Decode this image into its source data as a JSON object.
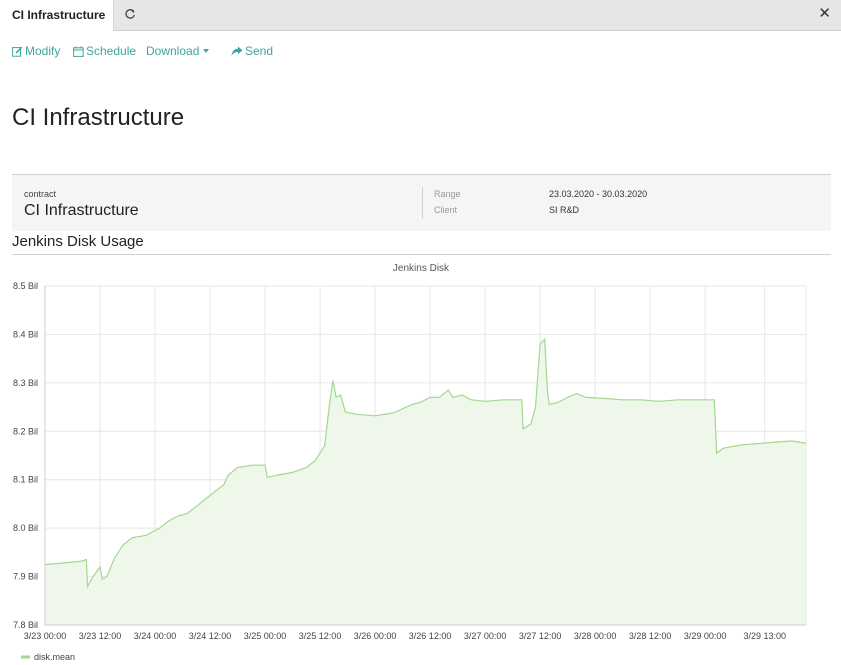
{
  "tab": {
    "label": "CI Infrastructure"
  },
  "toolbar": {
    "modify": "Modify",
    "schedule": "Schedule",
    "download": "Download",
    "send": "Send"
  },
  "page": {
    "title": "CI Infrastructure"
  },
  "info": {
    "type_label": "contract",
    "name": "CI Infrastructure",
    "range_label": "Range",
    "range_value": "23.03.2020 - 30.03.2020",
    "client_label": "Client",
    "client_value": "SI R&D"
  },
  "section": {
    "title": "Jenkins Disk Usage"
  },
  "colors": {
    "accent": "#3ea69a",
    "series": "#a3d890",
    "fill": "#eef7ea"
  },
  "chart_data": {
    "type": "area",
    "title": "Jenkins Disk",
    "xlabel": "",
    "ylabel": "",
    "ylim": [
      7.8,
      8.5
    ],
    "xlim": [
      0,
      166
    ],
    "grid": true,
    "legend": "bottom-left",
    "y_ticks": [
      "7.8 Bil",
      "7.9 Bil",
      "8.0 Bil",
      "8.1 Bil",
      "8.2 Bil",
      "8.3 Bil",
      "8.4 Bil",
      "8.5 Bil"
    ],
    "x_ticks": [
      {
        "h": 0,
        "label": "3/23 00:00"
      },
      {
        "h": 12,
        "label": "3/23 12:00"
      },
      {
        "h": 24,
        "label": "3/24 00:00"
      },
      {
        "h": 36,
        "label": "3/24 12:00"
      },
      {
        "h": 48,
        "label": "3/25 00:00"
      },
      {
        "h": 60,
        "label": "3/25 12:00"
      },
      {
        "h": 72,
        "label": "3/26 00:00"
      },
      {
        "h": 84,
        "label": "3/26 12:00"
      },
      {
        "h": 96,
        "label": "3/27 00:00"
      },
      {
        "h": 108,
        "label": "3/27 12:00"
      },
      {
        "h": 120,
        "label": "3/28 00:00"
      },
      {
        "h": 132,
        "label": "3/28 12:00"
      },
      {
        "h": 144,
        "label": "3/29 00:00"
      },
      {
        "h": 157,
        "label": "3/29 13:00"
      }
    ],
    "series": [
      {
        "name": "disk.mean",
        "points": [
          [
            0,
            7.925
          ],
          [
            4,
            7.928
          ],
          [
            8,
            7.932
          ],
          [
            9,
            7.935
          ],
          [
            9.3,
            7.88
          ],
          [
            10.5,
            7.9
          ],
          [
            12,
            7.92
          ],
          [
            12.5,
            7.895
          ],
          [
            13.5,
            7.9
          ],
          [
            15,
            7.935
          ],
          [
            17,
            7.965
          ],
          [
            19,
            7.98
          ],
          [
            22,
            7.985
          ],
          [
            25,
            8.0
          ],
          [
            27,
            8.015
          ],
          [
            29,
            8.025
          ],
          [
            31,
            8.03
          ],
          [
            33,
            8.045
          ],
          [
            35,
            8.06
          ],
          [
            37,
            8.075
          ],
          [
            39,
            8.09
          ],
          [
            40,
            8.11
          ],
          [
            42,
            8.125
          ],
          [
            45,
            8.13
          ],
          [
            48,
            8.13
          ],
          [
            48.5,
            8.105
          ],
          [
            51,
            8.11
          ],
          [
            54,
            8.115
          ],
          [
            57,
            8.125
          ],
          [
            59,
            8.14
          ],
          [
            61,
            8.17
          ],
          [
            62,
            8.25
          ],
          [
            62.8,
            8.305
          ],
          [
            63.5,
            8.27
          ],
          [
            64.5,
            8.275
          ],
          [
            65.5,
            8.24
          ],
          [
            68,
            8.235
          ],
          [
            72,
            8.232
          ],
          [
            76,
            8.238
          ],
          [
            80,
            8.255
          ],
          [
            82,
            8.26
          ],
          [
            84,
            8.27
          ],
          [
            86,
            8.27
          ],
          [
            88,
            8.285
          ],
          [
            89,
            8.27
          ],
          [
            91,
            8.275
          ],
          [
            93,
            8.265
          ],
          [
            96,
            8.262
          ],
          [
            100,
            8.265
          ],
          [
            104,
            8.265
          ],
          [
            104.3,
            8.205
          ],
          [
            106,
            8.215
          ],
          [
            107,
            8.25
          ],
          [
            108,
            8.38
          ],
          [
            109,
            8.39
          ],
          [
            109.6,
            8.285
          ],
          [
            110,
            8.255
          ],
          [
            112,
            8.26
          ],
          [
            114,
            8.27
          ],
          [
            116,
            8.278
          ],
          [
            118,
            8.27
          ],
          [
            122,
            8.268
          ],
          [
            126,
            8.265
          ],
          [
            130,
            8.265
          ],
          [
            134,
            8.262
          ],
          [
            138,
            8.265
          ],
          [
            142,
            8.265
          ],
          [
            144,
            8.265
          ],
          [
            146,
            8.265
          ],
          [
            146.5,
            8.155
          ],
          [
            148,
            8.165
          ],
          [
            152,
            8.172
          ],
          [
            156,
            8.175
          ],
          [
            160,
            8.178
          ],
          [
            163,
            8.18
          ],
          [
            166,
            8.175
          ]
        ]
      }
    ]
  }
}
